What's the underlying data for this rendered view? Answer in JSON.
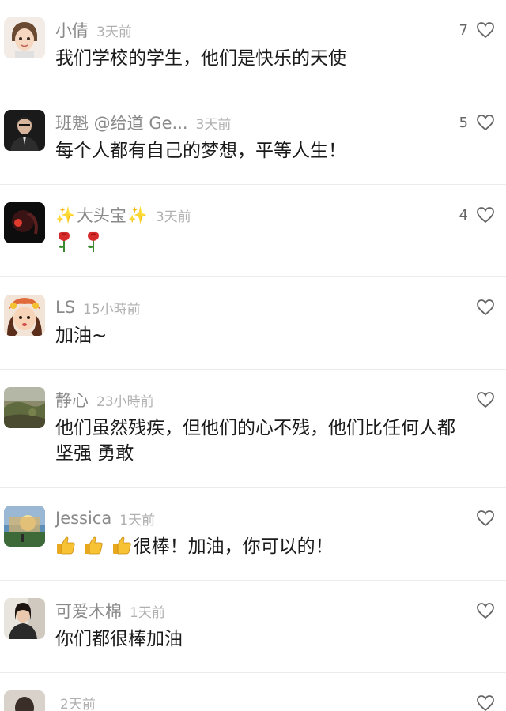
{
  "comments": [
    {
      "username": "小倩",
      "time": "3天前",
      "likes": "7",
      "text": "我们学校的学生，他们是快乐的天使"
    },
    {
      "username": "班魁 @给道 Ge...",
      "time": "3天前",
      "likes": "5",
      "text": "每个人都有自己的梦想，平等人生！"
    },
    {
      "username": "大头宝",
      "sparkle": "✨",
      "time": "3天前",
      "likes": "4",
      "emoji": [
        "rose",
        "rose"
      ]
    },
    {
      "username": "LS",
      "time": "15小時前",
      "likes": "",
      "text": "加油~"
    },
    {
      "username": "静心",
      "time": "23小時前",
      "likes": "",
      "text_line1": "他们虽然残疾，但他们的心不残，他们比任何人都",
      "text_line2": "坚强 勇敢"
    },
    {
      "username": "Jessica",
      "time": "1天前",
      "likes": "",
      "emoji": [
        "thumbs-up",
        "thumbs-up",
        "thumbs-up"
      ],
      "text": "很棒！加油，你可以的！"
    },
    {
      "username": "可爱木棉",
      "time": "1天前",
      "likes": "",
      "text": "你们都很棒加油"
    },
    {
      "username": "",
      "time": "2天前",
      "likes": ""
    }
  ],
  "colors": {
    "username": "#8a8a8a",
    "timestamp": "#b0b0b0",
    "body_text": "#1a1a1a",
    "divider": "#ececec"
  }
}
